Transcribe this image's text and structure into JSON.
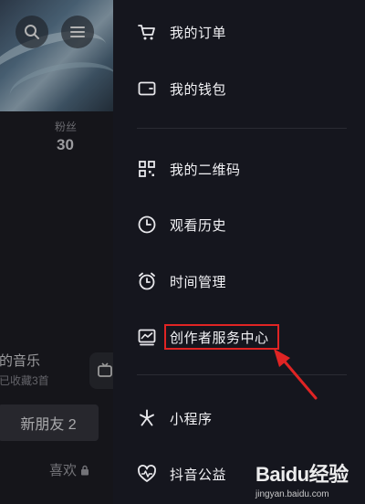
{
  "background_profile": {
    "fans_label": "粉丝",
    "fans_count": "30",
    "music_title": "我的音乐",
    "music_title_visible": "我的音乐",
    "music_subtitle": "已收藏3首",
    "new_friend_button": "新朋友 2",
    "likes_tab": "喜欢"
  },
  "drawer": {
    "items": [
      {
        "label": "我的订单",
        "icon": "cart-icon"
      },
      {
        "label": "我的钱包",
        "icon": "wallet-icon"
      },
      {
        "label": "我的二维码",
        "icon": "qrcode-icon"
      },
      {
        "label": "观看历史",
        "icon": "clock-icon"
      },
      {
        "label": "时间管理",
        "icon": "alarm-clock-icon"
      },
      {
        "label": "创作者服务中心",
        "icon": "chart-icon"
      },
      {
        "label": "小程序",
        "icon": "asterisk-icon"
      },
      {
        "label": "抖音公益",
        "icon": "heart-pulse-icon"
      }
    ]
  },
  "annotation": {
    "highlight_color": "#e02424"
  },
  "watermark": {
    "brand": "Baidu经验",
    "url": "jingyan.baidu.com"
  },
  "colors": {
    "drawer_bg": "#15161e",
    "text": "#f2f2f5",
    "icon": "#e8e8ec"
  }
}
